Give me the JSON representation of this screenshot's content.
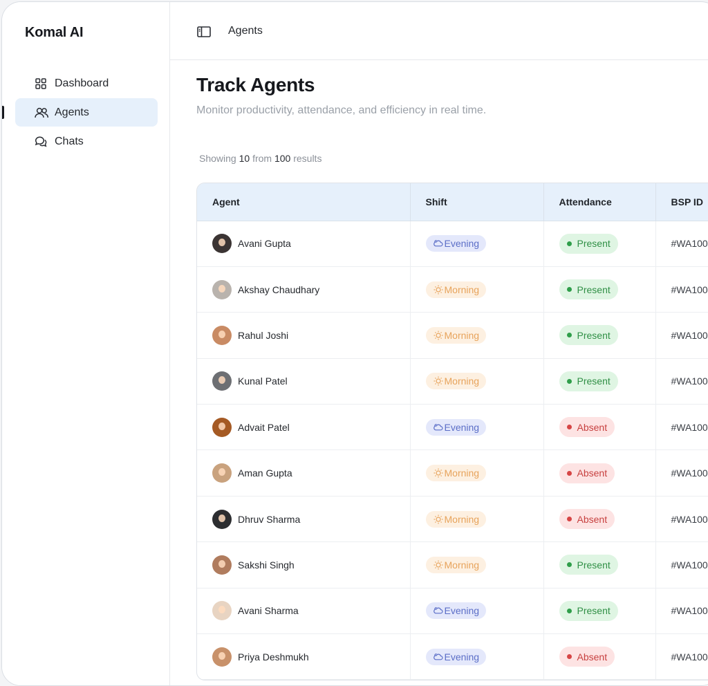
{
  "app": {
    "brand": "Komal AI"
  },
  "sidebar": {
    "items": [
      {
        "label": "Dashboard",
        "icon": "grid-icon",
        "active": false
      },
      {
        "label": "Agents",
        "icon": "users-icon",
        "active": true
      },
      {
        "label": "Chats",
        "icon": "chat-bubbles-icon",
        "active": false
      }
    ]
  },
  "topbar": {
    "breadcrumb": "Agents",
    "toggle_icon": "sidebar-toggle-icon"
  },
  "page": {
    "title": "Track Agents",
    "subtitle": "Monitor productivity, attendance, and efficiency in real time."
  },
  "results": {
    "prefix": "Showing",
    "shown": "10",
    "middle": "from",
    "total": "100",
    "suffix": "results"
  },
  "table": {
    "columns": [
      "Agent",
      "Shift",
      "Attendance",
      "BSP ID"
    ],
    "rows": [
      {
        "name": "Avani Gupta",
        "shift": "Evening",
        "attendance": "Present",
        "bsp": "#WA100",
        "avatar_color": "#3b3433"
      },
      {
        "name": "Akshay Chaudhary",
        "shift": "Morning",
        "attendance": "Present",
        "bsp": "#WA100",
        "avatar_color": "#b9b3ad"
      },
      {
        "name": "Rahul Joshi",
        "shift": "Morning",
        "attendance": "Present",
        "bsp": "#WA100",
        "avatar_color": "#c98b64"
      },
      {
        "name": "Kunal Patel",
        "shift": "Morning",
        "attendance": "Present",
        "bsp": "#WA100",
        "avatar_color": "#6d6f73"
      },
      {
        "name": "Advait Patel",
        "shift": "Evening",
        "attendance": "Absent",
        "bsp": "#WA100",
        "avatar_color": "#a55a24"
      },
      {
        "name": "Aman Gupta",
        "shift": "Morning",
        "attendance": "Absent",
        "bsp": "#WA100",
        "avatar_color": "#c9a27e"
      },
      {
        "name": "Dhruv Sharma",
        "shift": "Morning",
        "attendance": "Absent",
        "bsp": "#WA100",
        "avatar_color": "#2c2d30"
      },
      {
        "name": "Sakshi Singh",
        "shift": "Morning",
        "attendance": "Present",
        "bsp": "#WA100",
        "avatar_color": "#b07c5e"
      },
      {
        "name": "Avani Sharma",
        "shift": "Evening",
        "attendance": "Present",
        "bsp": "#WA100",
        "avatar_color": "#e8d4c2"
      },
      {
        "name": "Priya Deshmukh",
        "shift": "Evening",
        "attendance": "Absent",
        "bsp": "#WA100",
        "avatar_color": "#c8916a"
      }
    ]
  },
  "colors": {
    "accent_bg": "#e6f0fb",
    "present": "#2f8f45",
    "absent": "#c7403f",
    "evening": "#5b6ec7",
    "morning": "#e7a35b"
  }
}
